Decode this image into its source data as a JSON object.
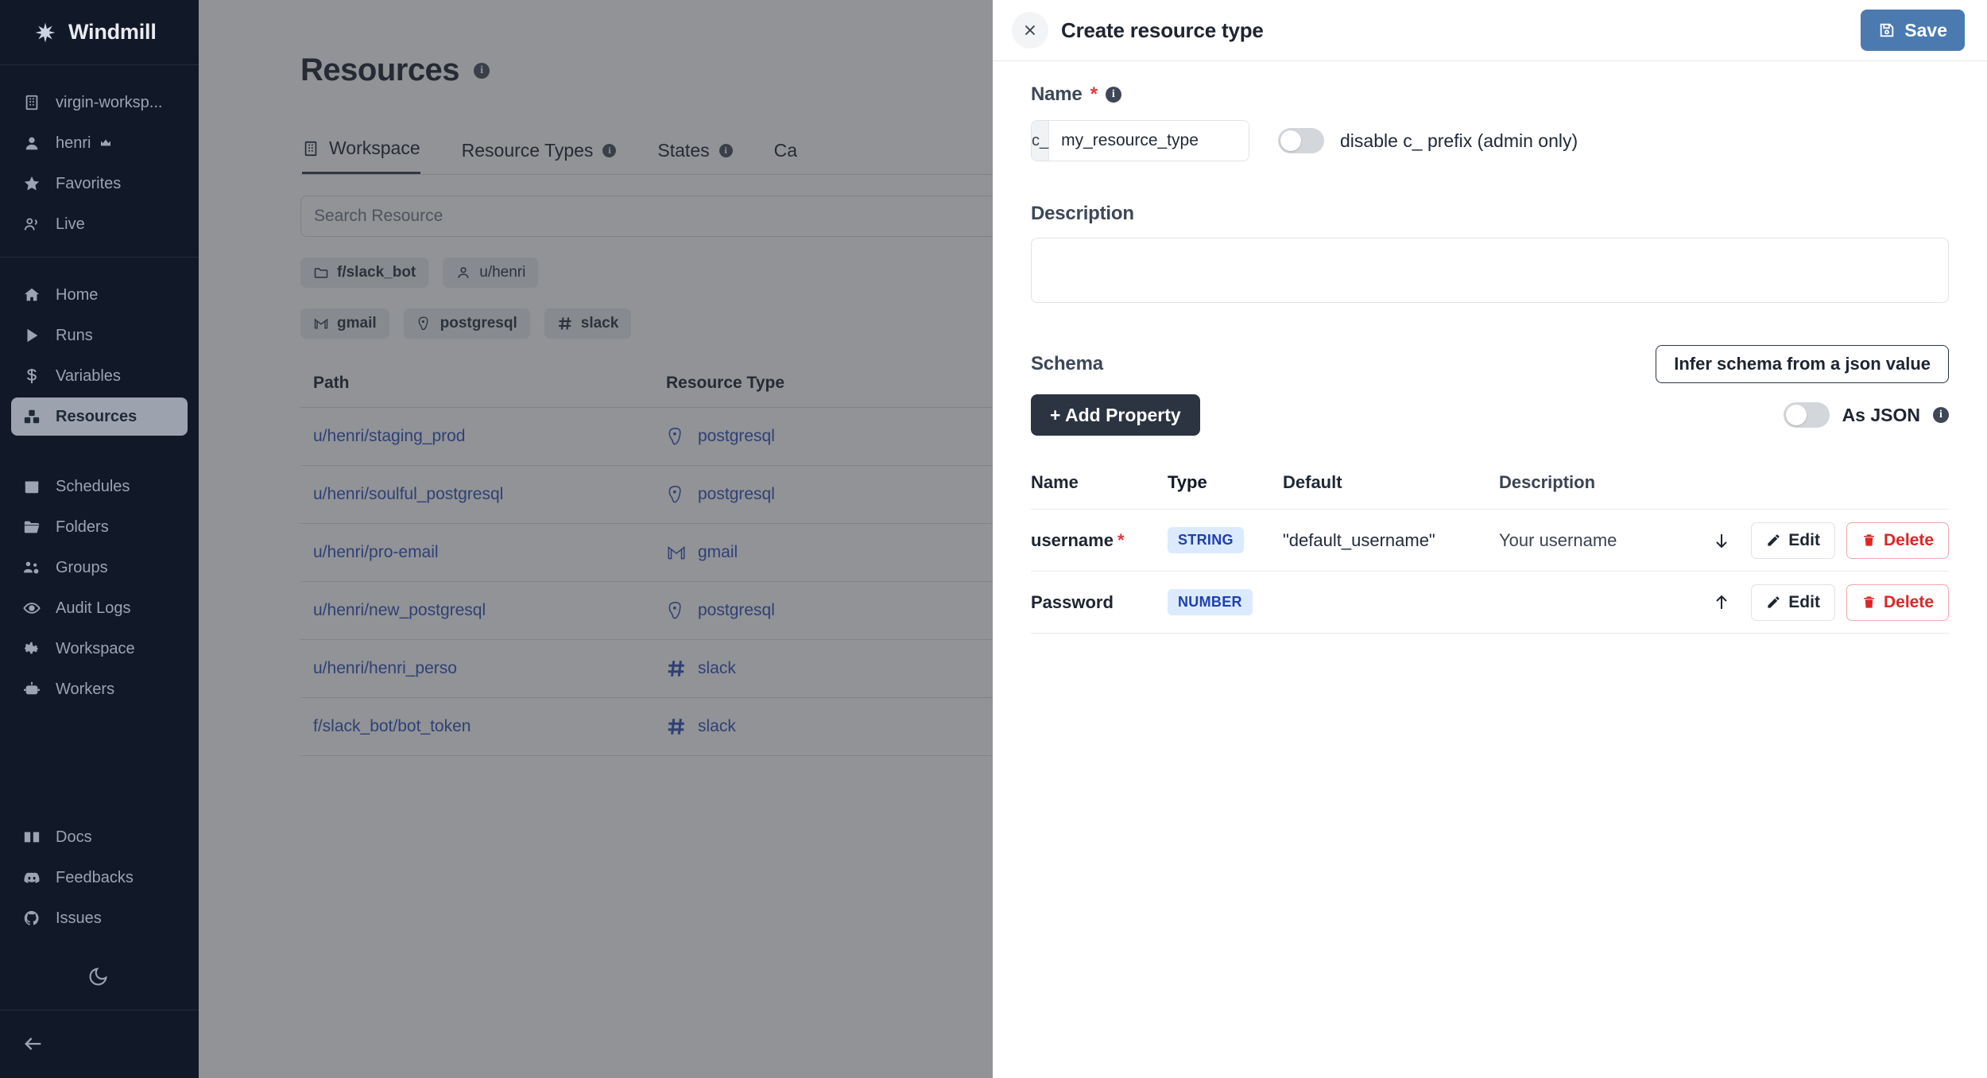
{
  "sidebar": {
    "brand": "Windmill",
    "brand_icon": "windmill-logo-icon",
    "workspace": {
      "label": "virgin-worksp...",
      "icon": "building-icon"
    },
    "user": {
      "label": "henri",
      "icon": "user-icon",
      "badge_icon": "crown-icon"
    },
    "top_items": [
      {
        "label": "Favorites",
        "icon": "star-icon"
      },
      {
        "label": "Live",
        "icon": "users-icon"
      }
    ],
    "main_items": [
      {
        "label": "Home",
        "icon": "home-icon",
        "active": false
      },
      {
        "label": "Runs",
        "icon": "play-icon",
        "active": false
      },
      {
        "label": "Variables",
        "icon": "dollar-icon",
        "active": false
      },
      {
        "label": "Resources",
        "icon": "boxes-icon",
        "active": true
      }
    ],
    "admin_items": [
      {
        "label": "Schedules",
        "icon": "calendar-icon"
      },
      {
        "label": "Folders",
        "icon": "folder-icon"
      },
      {
        "label": "Groups",
        "icon": "groups-icon"
      },
      {
        "label": "Audit Logs",
        "icon": "eye-icon"
      },
      {
        "label": "Workspace",
        "icon": "gear-icon"
      },
      {
        "label": "Workers",
        "icon": "robot-icon"
      }
    ],
    "footer_items": [
      {
        "label": "Docs",
        "icon": "book-icon"
      },
      {
        "label": "Feedbacks",
        "icon": "discord-icon"
      },
      {
        "label": "Issues",
        "icon": "github-icon"
      }
    ],
    "theme_toggle_icon": "moon-icon",
    "collapse_icon": "arrow-left-icon"
  },
  "main": {
    "page_title": "Resources",
    "page_title_info_icon": "info-icon",
    "tabs": [
      {
        "label": "Workspace",
        "icon": "building-icon",
        "active": true,
        "info": false
      },
      {
        "label": "Resource Types",
        "icon": "",
        "active": false,
        "info": true
      },
      {
        "label": "States",
        "icon": "",
        "active": false,
        "info": true
      },
      {
        "label": "Ca",
        "icon": "",
        "active": false,
        "info": false
      }
    ],
    "search": {
      "placeholder": "Search Resource",
      "value": ""
    },
    "owner_chips": [
      {
        "label": "f/slack_bot",
        "icon": "folder-icon"
      },
      {
        "label": "u/henri",
        "icon": "user-icon"
      }
    ],
    "type_chips": [
      {
        "label": "gmail",
        "icon": "gmail-icon"
      },
      {
        "label": "postgresql",
        "icon": "postgres-icon"
      },
      {
        "label": "slack",
        "icon": "slack-icon"
      }
    ],
    "table": {
      "columns": [
        "Path",
        "Resource Type"
      ],
      "rows": [
        {
          "path": "u/henri/staging_prod",
          "type": "postgresql",
          "type_icon": "postgres-icon"
        },
        {
          "path": "u/henri/soulful_postgresql",
          "type": "postgresql",
          "type_icon": "postgres-icon"
        },
        {
          "path": "u/henri/pro-email",
          "type": "gmail",
          "type_icon": "gmail-icon"
        },
        {
          "path": "u/henri/new_postgresql",
          "type": "postgresql",
          "type_icon": "postgres-icon"
        },
        {
          "path": "u/henri/henri_perso",
          "type": "slack",
          "type_icon": "slack-icon"
        },
        {
          "path": "f/slack_bot/bot_token",
          "type": "slack",
          "type_icon": "slack-icon"
        }
      ]
    }
  },
  "drawer": {
    "title": "Create resource type",
    "close_icon": "close-icon",
    "save_label": "Save",
    "save_icon": "save-icon",
    "save_color": "#4a7ab0",
    "name": {
      "label": "Name",
      "required_mark": "*",
      "info_icon": "info-icon",
      "prefix": "c_",
      "value": "my_resource_type",
      "placeholder": ""
    },
    "disable_prefix_toggle": {
      "label": "disable c_ prefix (admin only)",
      "on": false
    },
    "description": {
      "label": "Description",
      "value": "",
      "placeholder": ""
    },
    "schema": {
      "label": "Schema",
      "infer_button": "Infer schema from a json value",
      "add_property_button": "+ Add Property",
      "as_json": {
        "label": "As JSON",
        "on": false,
        "info_icon": "info-icon"
      },
      "columns": [
        "Name",
        "Type",
        "Default",
        "Description"
      ],
      "properties": [
        {
          "name": "username",
          "required": true,
          "type": "STRING",
          "default": "\"default_username\"",
          "description": "Your username",
          "move_icon": "arrow-down-icon",
          "edit_label": "Edit",
          "edit_icon": "pencil-icon",
          "delete_label": "Delete",
          "delete_icon": "trash-icon"
        },
        {
          "name": "Password",
          "required": false,
          "type": "NUMBER",
          "default": "",
          "description": "",
          "move_icon": "arrow-up-icon",
          "edit_label": "Edit",
          "edit_icon": "pencil-icon",
          "delete_label": "Delete",
          "delete_icon": "trash-icon"
        }
      ]
    }
  },
  "colors": {
    "sidebar_bg": "#111827",
    "accent_blue": "#4a7ab0",
    "badge_bg": "#dbeafe",
    "badge_text": "#1e40af",
    "danger": "#dc2626",
    "link": "#2747b8"
  }
}
